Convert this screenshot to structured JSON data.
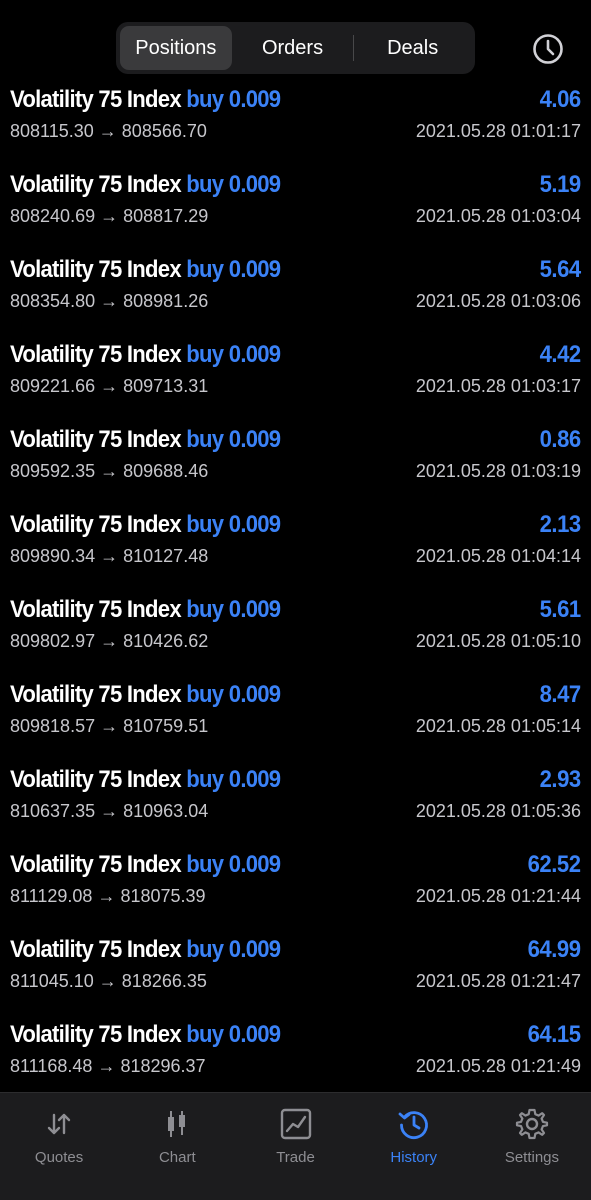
{
  "header": {
    "tabs": [
      {
        "label": "Positions",
        "active": true
      },
      {
        "label": "Orders",
        "active": false
      },
      {
        "label": "Deals",
        "active": false
      }
    ],
    "clock_icon": "clock-icon"
  },
  "accent_color": "#3b82f6",
  "history": [
    {
      "symbol": "Volatility 75 Index",
      "side": "buy",
      "volume": "0.009",
      "profit": "4.06",
      "open_price": "808115.30",
      "arrow": "→",
      "close_price": "808566.70",
      "time": "2021.05.28 01:01:17"
    },
    {
      "symbol": "Volatility 75 Index",
      "side": "buy",
      "volume": "0.009",
      "profit": "5.19",
      "open_price": "808240.69",
      "arrow": "→",
      "close_price": "808817.29",
      "time": "2021.05.28 01:03:04"
    },
    {
      "symbol": "Volatility 75 Index",
      "side": "buy",
      "volume": "0.009",
      "profit": "5.64",
      "open_price": "808354.80",
      "arrow": "→",
      "close_price": "808981.26",
      "time": "2021.05.28 01:03:06"
    },
    {
      "symbol": "Volatility 75 Index",
      "side": "buy",
      "volume": "0.009",
      "profit": "4.42",
      "open_price": "809221.66",
      "arrow": "→",
      "close_price": "809713.31",
      "time": "2021.05.28 01:03:17"
    },
    {
      "symbol": "Volatility 75 Index",
      "side": "buy",
      "volume": "0.009",
      "profit": "0.86",
      "open_price": "809592.35",
      "arrow": "→",
      "close_price": "809688.46",
      "time": "2021.05.28 01:03:19"
    },
    {
      "symbol": "Volatility 75 Index",
      "side": "buy",
      "volume": "0.009",
      "profit": "2.13",
      "open_price": "809890.34",
      "arrow": "→",
      "close_price": "810127.48",
      "time": "2021.05.28 01:04:14"
    },
    {
      "symbol": "Volatility 75 Index",
      "side": "buy",
      "volume": "0.009",
      "profit": "5.61",
      "open_price": "809802.97",
      "arrow": "→",
      "close_price": "810426.62",
      "time": "2021.05.28 01:05:10"
    },
    {
      "symbol": "Volatility 75 Index",
      "side": "buy",
      "volume": "0.009",
      "profit": "8.47",
      "open_price": "809818.57",
      "arrow": "→",
      "close_price": "810759.51",
      "time": "2021.05.28 01:05:14"
    },
    {
      "symbol": "Volatility 75 Index",
      "side": "buy",
      "volume": "0.009",
      "profit": "2.93",
      "open_price": "810637.35",
      "arrow": "→",
      "close_price": "810963.04",
      "time": "2021.05.28 01:05:36"
    },
    {
      "symbol": "Volatility 75 Index",
      "side": "buy",
      "volume": "0.009",
      "profit": "62.52",
      "open_price": "811129.08",
      "arrow": "→",
      "close_price": "818075.39",
      "time": "2021.05.28 01:21:44"
    },
    {
      "symbol": "Volatility 75 Index",
      "side": "buy",
      "volume": "0.009",
      "profit": "64.99",
      "open_price": "811045.10",
      "arrow": "→",
      "close_price": "818266.35",
      "time": "2021.05.28 01:21:47"
    },
    {
      "symbol": "Volatility 75 Index",
      "side": "buy",
      "volume": "0.009",
      "profit": "64.15",
      "open_price": "811168.48",
      "arrow": "→",
      "close_price": "818296.37",
      "time": "2021.05.28 01:21:49"
    }
  ],
  "tabbar": {
    "items": [
      {
        "label": "Quotes",
        "icon": "quotes-arrows-icon",
        "active": false
      },
      {
        "label": "Chart",
        "icon": "candlestick-chart-icon",
        "active": false
      },
      {
        "label": "Trade",
        "icon": "trade-chart-icon",
        "active": false
      },
      {
        "label": "History",
        "icon": "history-clock-icon",
        "active": true
      },
      {
        "label": "Settings",
        "icon": "gear-icon",
        "active": false
      }
    ]
  }
}
